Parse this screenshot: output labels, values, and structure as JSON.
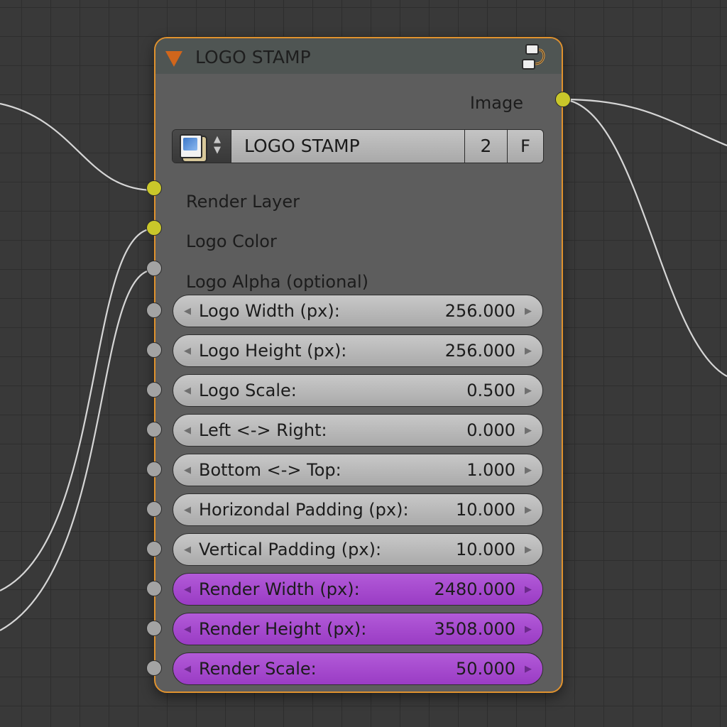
{
  "node": {
    "title": "LOGO STAMP",
    "header_icon": "node-group-icon",
    "output_label": "Image",
    "group": {
      "name": "LOGO STAMP",
      "users": "2",
      "fake_user": "F"
    },
    "inputs": [
      {
        "label": "Render Layer",
        "socket": "yellow"
      },
      {
        "label": "Logo Color",
        "socket": "yellow"
      },
      {
        "label": "Logo Alpha (optional)",
        "socket": "gray"
      }
    ],
    "fields": [
      {
        "label": "Logo Width (px):",
        "value": "256.000",
        "style": "gray"
      },
      {
        "label": "Logo Height (px):",
        "value": "256.000",
        "style": "gray"
      },
      {
        "label": "Logo Scale:",
        "value": "0.500",
        "style": "gray"
      },
      {
        "label": "Left <-> Right:",
        "value": "0.000",
        "style": "gray"
      },
      {
        "label": "Bottom <-> Top:",
        "value": "1.000",
        "style": "gray"
      },
      {
        "label": "Horizondal Padding (px):",
        "value": "10.000",
        "style": "gray"
      },
      {
        "label": "Vertical Padding (px):",
        "value": "10.000",
        "style": "gray"
      },
      {
        "label": "Render Width (px):",
        "value": "2480.000",
        "style": "purple"
      },
      {
        "label": "Render Height (px):",
        "value": "3508.000",
        "style": "purple"
      },
      {
        "label": "Render Scale:",
        "value": "50.000",
        "style": "purple"
      }
    ]
  },
  "colors": {
    "frame": "#e0922e",
    "socket_yellow": "#c9c72a",
    "socket_gray": "#a3a3a3",
    "field_purple": "#a64ccf"
  }
}
